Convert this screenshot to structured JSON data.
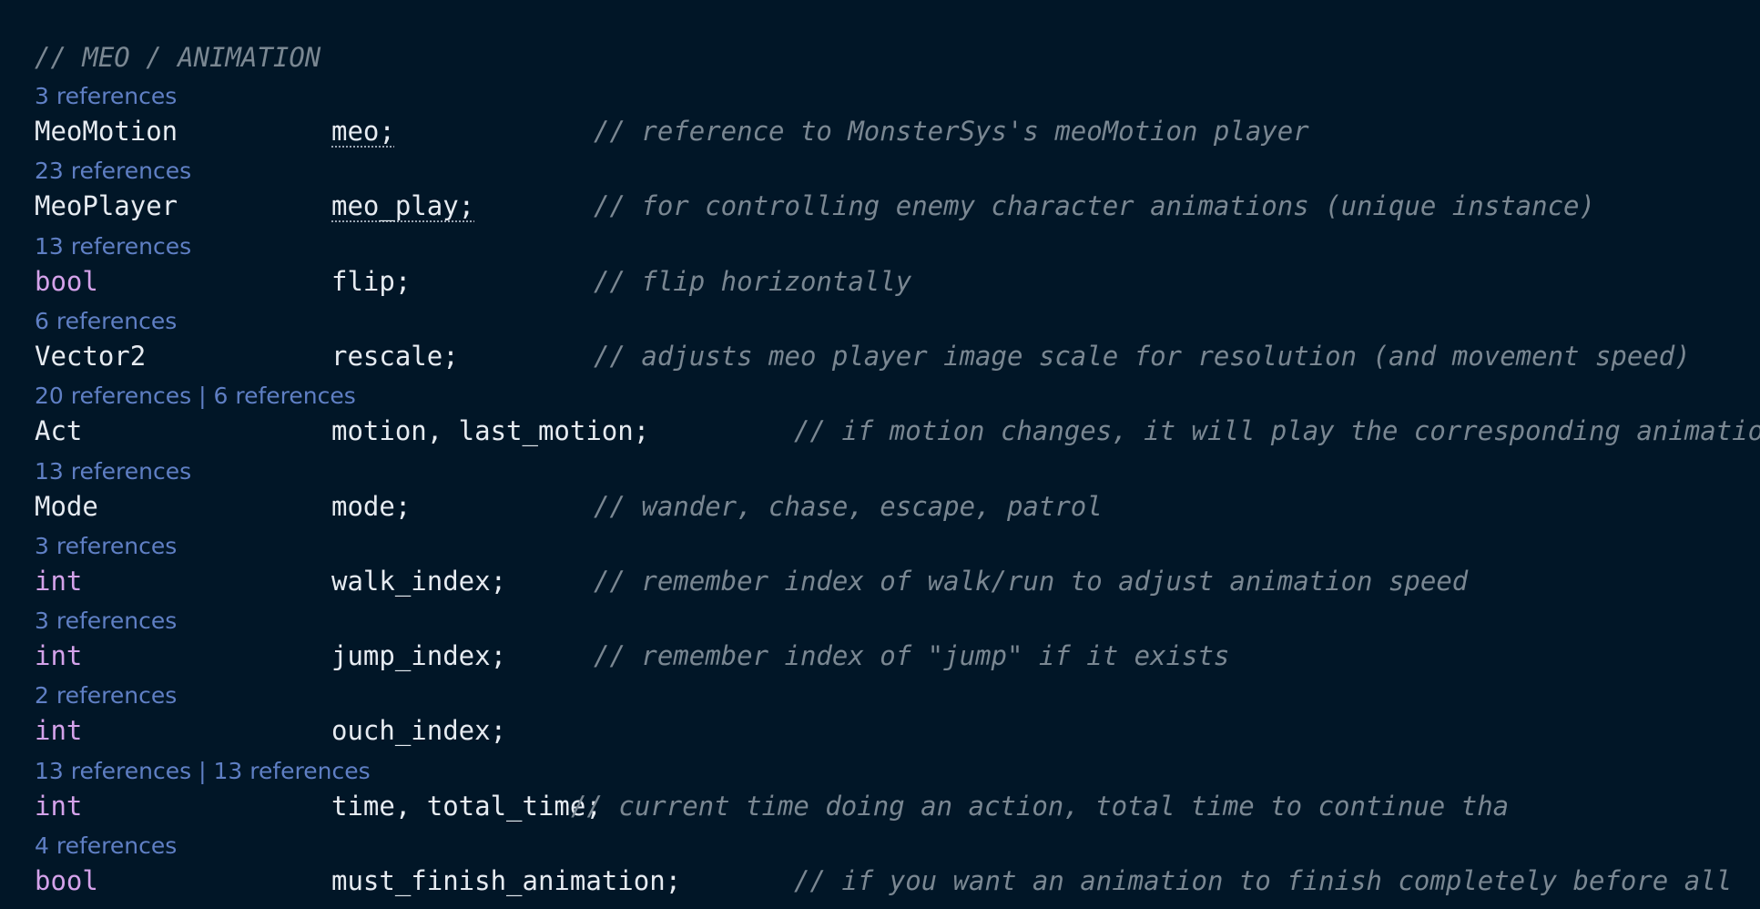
{
  "header_comment": "// MEO / ANIMATION",
  "members": [
    {
      "lens": "3 references",
      "lens2": "",
      "type": "MeoMotion",
      "type_kind": "class",
      "decl": "meo;",
      "comment": "// reference to MonsterSys's meoMotion player",
      "underlined": true
    },
    {
      "lens": "23 references",
      "lens2": "",
      "type": "MeoPlayer",
      "type_kind": "class",
      "decl": "meo_play;",
      "comment": "// for controlling enemy character animations (unique instance)",
      "underlined": true
    },
    {
      "lens": "13 references",
      "lens2": "",
      "type": "bool",
      "type_kind": "keyword",
      "decl": "flip;",
      "comment": "// flip horizontally",
      "underlined": false
    },
    {
      "lens": "6 references",
      "lens2": "",
      "type": "Vector2",
      "type_kind": "class",
      "decl": "rescale;",
      "comment": "// adjusts meo player image scale for resolution (and movement speed)",
      "underlined": false
    },
    {
      "lens": "20 references",
      "lens2": "6 references",
      "type": "Act",
      "type_kind": "class",
      "decl": "motion, last_motion;",
      "comment": "// if motion changes, it will play the corresponding animation",
      "underlined": false
    },
    {
      "lens": "13 references",
      "lens2": "",
      "type": "Mode",
      "type_kind": "class",
      "decl": "mode;",
      "comment": "// wander, chase, escape, patrol",
      "underlined": false
    },
    {
      "lens": "3 references",
      "lens2": "",
      "type": "int",
      "type_kind": "keyword",
      "decl": "walk_index;",
      "comment": "// remember index of walk/run to adjust animation speed",
      "underlined": false
    },
    {
      "lens": "3 references",
      "lens2": "",
      "type": "int",
      "type_kind": "keyword",
      "decl": "jump_index;",
      "comment": "// remember index of \"jump\" if it exists",
      "underlined": false
    },
    {
      "lens": "2 references",
      "lens2": "",
      "type": "int",
      "type_kind": "keyword",
      "decl": "ouch_index;",
      "comment": "",
      "underlined": false
    },
    {
      "lens": "13 references",
      "lens2": "13 references",
      "type": "int",
      "type_kind": "keyword",
      "decl": "time, total_time;",
      "comment": "// current time doing an action, total time to continue tha",
      "underlined": false
    },
    {
      "lens": "4 references",
      "lens2": "",
      "type": "bool",
      "type_kind": "keyword",
      "decl": "must_finish_animation;",
      "comment": "// if you want an animation to finish completely before all",
      "underlined": false
    }
  ]
}
